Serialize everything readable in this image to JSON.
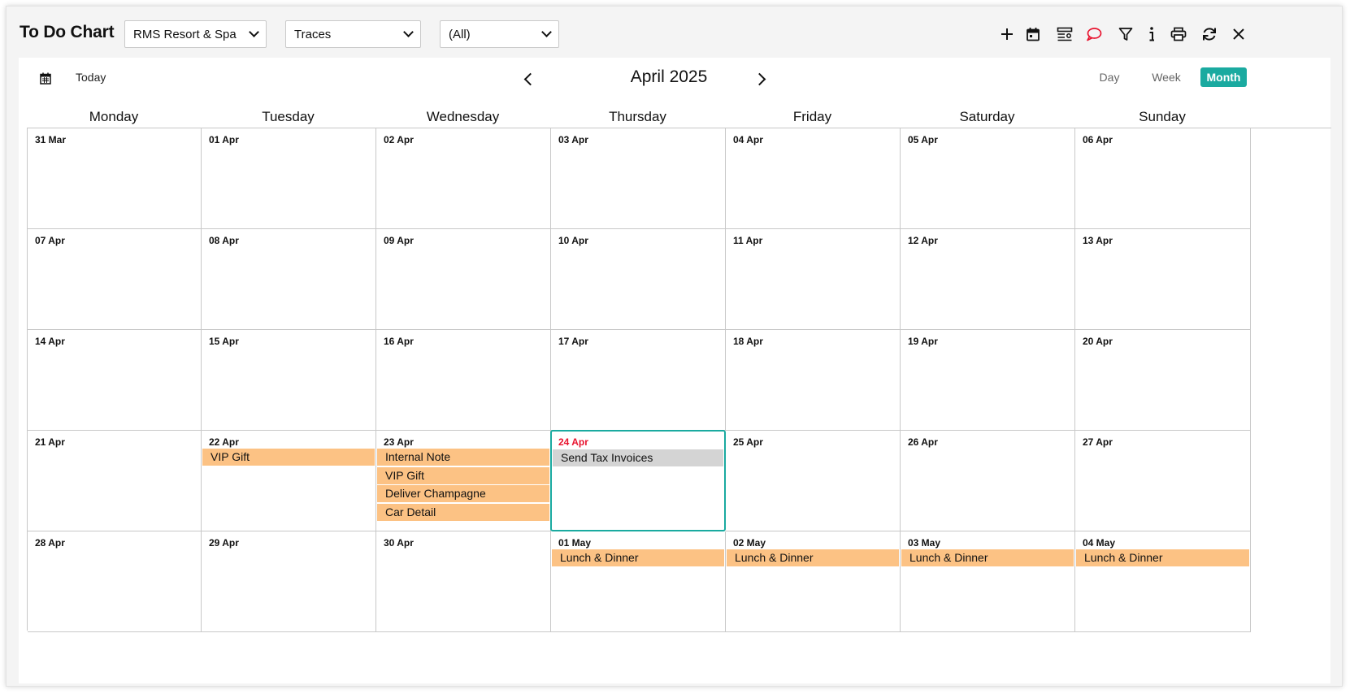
{
  "header": {
    "title": "To Do Chart",
    "property_select": "RMS Resort & Spa",
    "type_select": "Traces",
    "filter_select": "(All)"
  },
  "toolbar": {
    "icons": [
      "add-icon",
      "calendar-icon",
      "list-settings-icon",
      "chat-icon",
      "filter-icon",
      "info-icon",
      "print-icon",
      "refresh-icon",
      "close-icon"
    ],
    "chat_color": "#e8132e"
  },
  "nav": {
    "today_label": "Today",
    "month_title": "April 2025",
    "views": [
      "Day",
      "Week",
      "Month"
    ],
    "active_view": "Month"
  },
  "weekdays": [
    "Monday",
    "Tuesday",
    "Wednesday",
    "Thursday",
    "Friday",
    "Saturday",
    "Sunday"
  ],
  "weeks": [
    [
      "31 Mar",
      "01 Apr",
      "02 Apr",
      "03 Apr",
      "04 Apr",
      "05 Apr",
      "06 Apr"
    ],
    [
      "07 Apr",
      "08 Apr",
      "09 Apr",
      "10 Apr",
      "11 Apr",
      "12 Apr",
      "13 Apr"
    ],
    [
      "14 Apr",
      "15 Apr",
      "16 Apr",
      "17 Apr",
      "18 Apr",
      "19 Apr",
      "20 Apr"
    ],
    [
      "21 Apr",
      "22 Apr",
      "23 Apr",
      "24 Apr",
      "25 Apr",
      "26 Apr",
      "27 Apr"
    ],
    [
      "28 Apr",
      "29 Apr",
      "30 Apr",
      "01 May",
      "02 May",
      "03 May",
      "04 May"
    ]
  ],
  "today": "24 Apr",
  "events": {
    "22 Apr": [
      {
        "label": "VIP Gift",
        "color": "orange"
      }
    ],
    "23 Apr": [
      {
        "label": "Internal Note",
        "color": "orange"
      },
      {
        "label": "VIP Gift",
        "color": "orange"
      },
      {
        "label": "Deliver Champagne",
        "color": "orange"
      },
      {
        "label": "Car Detail",
        "color": "orange"
      }
    ],
    "24 Apr": [
      {
        "label": "Send Tax Invoices",
        "color": "grey"
      }
    ],
    "01 May": [
      {
        "label": "Lunch & Dinner",
        "color": "orange"
      }
    ],
    "02 May": [
      {
        "label": "Lunch & Dinner",
        "color": "orange"
      }
    ],
    "03 May": [
      {
        "label": "Lunch & Dinner",
        "color": "orange"
      }
    ],
    "04 May": [
      {
        "label": "Lunch & Dinner",
        "color": "orange"
      }
    ]
  },
  "colors": {
    "accent": "#1aaaa0",
    "event_orange": "#fcc284",
    "event_grey": "#d4d4d4",
    "today_text": "#e8132e"
  }
}
